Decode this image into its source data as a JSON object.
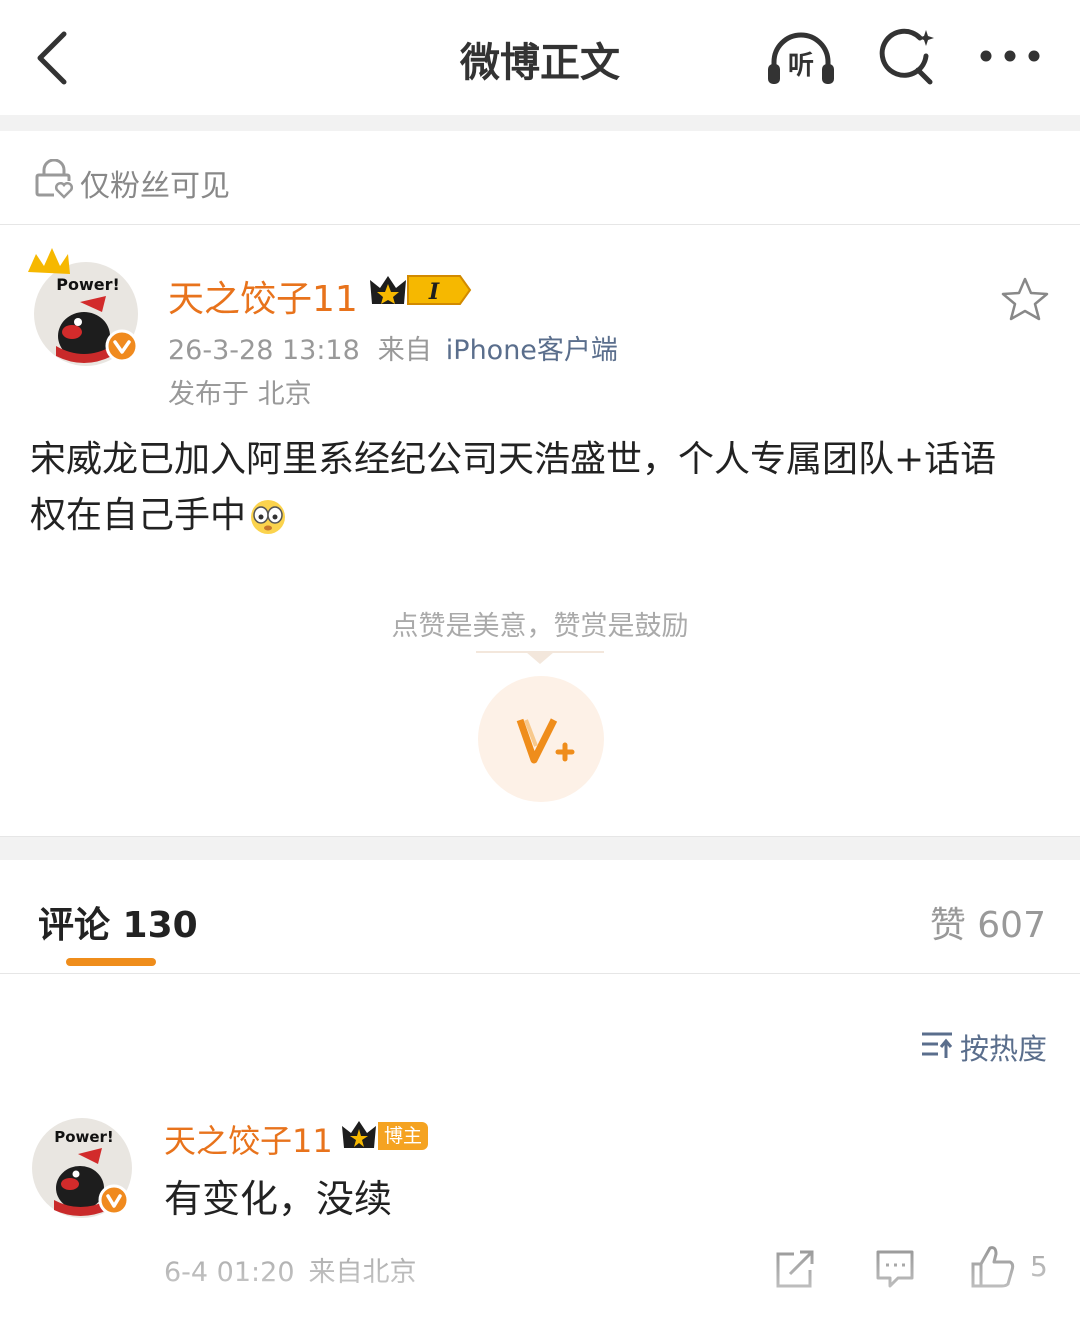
{
  "nav": {
    "title": "微博正文",
    "listen_label": "听",
    "icons": [
      "back-arrow-icon",
      "headphones-listen-icon",
      "search-icon",
      "more-dots-icon"
    ]
  },
  "visibility": {
    "label": "仅粉丝可见",
    "icon": "lock-heart-icon"
  },
  "post": {
    "author_name": "天之饺子11",
    "avatar_text": "Power!",
    "badge_text": "I",
    "time": "26-3-28 13:18",
    "from_label": "来自",
    "source": "iPhone客户端",
    "location": "发布于 北京",
    "text": "宋威龙已加入阿里系经纪公司天浩盛世，个人专属团队+话语权在自己手中"
  },
  "reward": {
    "tip": "点赞是美意，赞赏是鼓励",
    "icon": "reward-v-plus-icon"
  },
  "tabs": {
    "comments": "评论 130",
    "likes": "赞 607"
  },
  "sort": {
    "label": "按热度"
  },
  "comments": [
    {
      "author": "天之饺子11",
      "tag": "博主",
      "text": "有变化，没续",
      "time": "6-4 01:20",
      "location": "来自北京",
      "likes": "5"
    }
  ],
  "colors": {
    "accent": "#ef8d1b",
    "name": "#e8731c",
    "link": "#5a6e8c"
  }
}
